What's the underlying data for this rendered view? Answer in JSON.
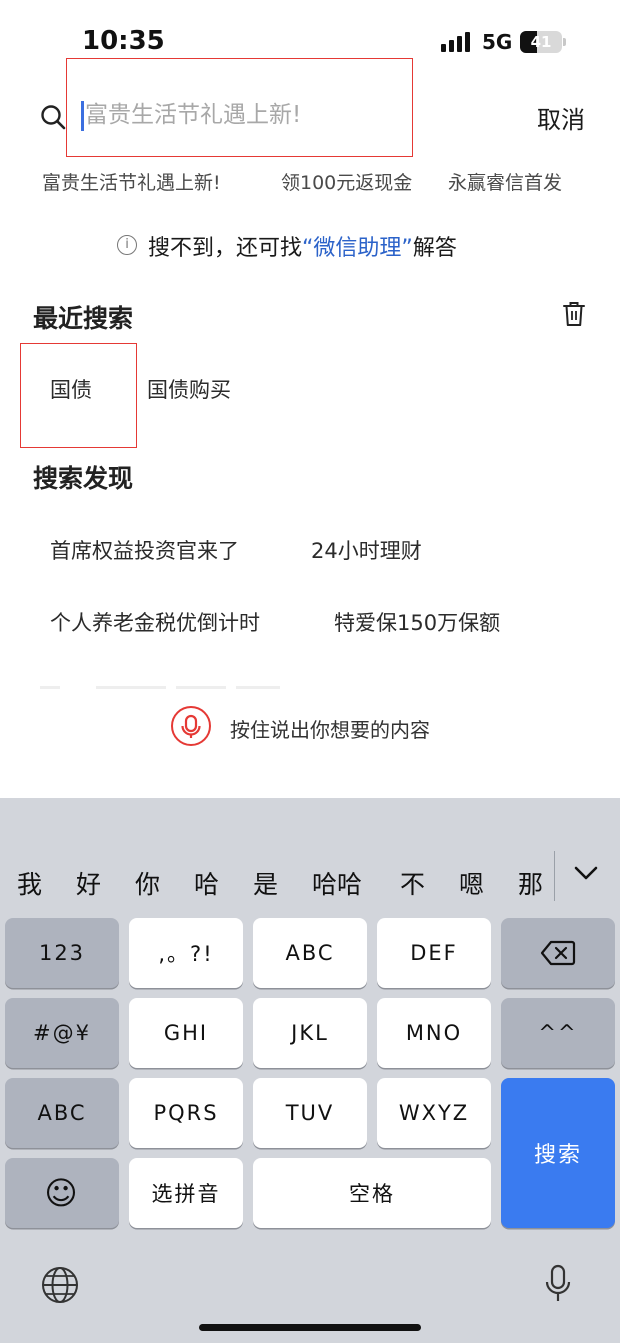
{
  "status_bar": {
    "time": "10:35",
    "network": "5G",
    "battery": "41",
    "battery_level": 0.41
  },
  "search": {
    "placeholder": "富贵生活节礼遇上新!",
    "value": "",
    "cancel_label": "取消"
  },
  "hot_keywords": [
    "富贵生活节礼遇上新!",
    "领100元返现金",
    "永赢睿信首发"
  ],
  "helper": {
    "text": "搜不到，还可找",
    "link": "“微信助理”",
    "suffix": "解答"
  },
  "recent": {
    "title": "最近搜索",
    "items": [
      "国债",
      "国债购买"
    ]
  },
  "discover": {
    "title": "搜索发现",
    "items": [
      "首席权益投资官来了",
      "24小时理财",
      "个人养老金税优倒计时",
      "特爱保150万保额"
    ]
  },
  "voice": {
    "hint": "按住说出你想要的内容"
  },
  "keyboard": {
    "candidates": [
      "我",
      "好",
      "你",
      "哈",
      "是",
      "哈哈",
      "不",
      "嗯",
      "那"
    ],
    "rows": {
      "r1": [
        "123",
        ",。?!",
        "ABC",
        "DEF"
      ],
      "r2": [
        "#@¥",
        "GHI",
        "JKL",
        "MNO",
        "^^"
      ],
      "r3": [
        "ABC",
        "PQRS",
        "TUV",
        "WXYZ"
      ],
      "r4": [
        "选拼音",
        "空格"
      ]
    },
    "search_key": "搜索",
    "emoji": "☺"
  },
  "colors": {
    "accent_blue": "#3a7bf0",
    "link_blue": "#2b62c9",
    "highlight_red": "#e53935",
    "keyboard_bg": "#d2d5db"
  }
}
